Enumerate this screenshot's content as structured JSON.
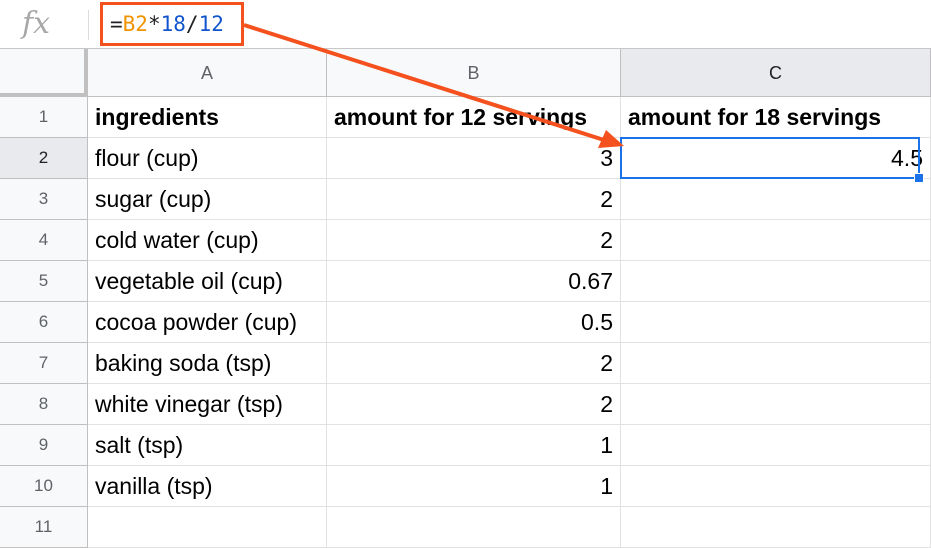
{
  "formula_bar": {
    "fx_icon": "fx",
    "formula_parts": [
      "=",
      "B2",
      "*",
      "18",
      "/",
      "12"
    ]
  },
  "columns": [
    "A",
    "B",
    "C"
  ],
  "rows": [
    {
      "num": "1",
      "a": "ingredients",
      "b": "amount for 12 servings",
      "c": "amount for 18 servings"
    },
    {
      "num": "2",
      "a": "flour (cup)",
      "b": "3",
      "c": "4.5"
    },
    {
      "num": "3",
      "a": "sugar (cup)",
      "b": "2",
      "c": ""
    },
    {
      "num": "4",
      "a": "cold water (cup)",
      "b": "2",
      "c": ""
    },
    {
      "num": "5",
      "a": "vegetable oil (cup)",
      "b": "0.67",
      "c": ""
    },
    {
      "num": "6",
      "a": "cocoa powder (cup)",
      "b": "0.5",
      "c": ""
    },
    {
      "num": "7",
      "a": "baking soda (tsp)",
      "b": "2",
      "c": ""
    },
    {
      "num": "8",
      "a": "white vinegar (tsp)",
      "b": "2",
      "c": ""
    },
    {
      "num": "9",
      "a": "salt (tsp)",
      "b": "1",
      "c": ""
    },
    {
      "num": "10",
      "a": "vanilla (tsp)",
      "b": "1",
      "c": ""
    },
    {
      "num": "11",
      "a": "",
      "b": "",
      "c": ""
    }
  ],
  "colors": {
    "annotation": "#f4511e",
    "selection": "#1a73e8",
    "cell_reference": "#f09300",
    "number_literal": "#1155cc"
  }
}
